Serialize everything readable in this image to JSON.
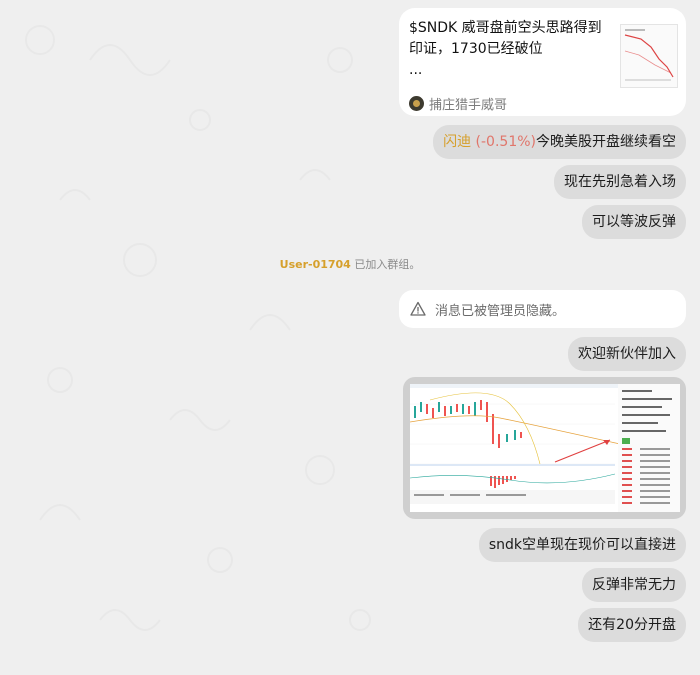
{
  "link_preview": {
    "title": "$SNDK 威哥盘前空头思路得到印证，1730已经破位",
    "ellipsis": "...",
    "author": "捕庄猎手威哥"
  },
  "messages": [
    {
      "id": "m1",
      "prefix_name": "闪迪",
      "prefix_change": "(-0.51%)",
      "text": "今晚美股开盘继续看空"
    },
    {
      "id": "m2",
      "text": "现在先别急着入场"
    },
    {
      "id": "m3",
      "text": "可以等波反弹"
    },
    {
      "id": "m5",
      "text": "欢迎新伙伴加入"
    },
    {
      "id": "m6",
      "text": "sndk空单现在现价可以直接进"
    },
    {
      "id": "m7",
      "text": "反弹非常无力"
    },
    {
      "id": "m8",
      "text": "还有20分开盘"
    }
  ],
  "system": {
    "username": "User-01704",
    "joined_text": "已加入群组。"
  },
  "hidden_message": {
    "text": "消息已被管理员隐藏。"
  },
  "colors": {
    "bubble": "#dcdcdc",
    "card": "#ffffff",
    "gold": "#d6a02c",
    "red": "#e03131"
  }
}
